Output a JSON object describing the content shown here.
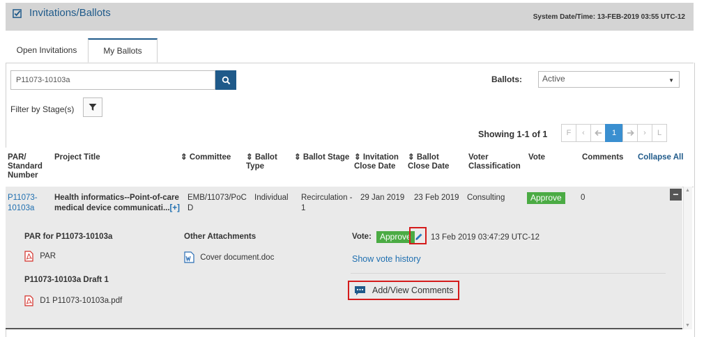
{
  "header": {
    "title": "Invitations/Ballots",
    "system_datetime": "System Date/Time: 13-FEB-2019  03:55 UTC-12"
  },
  "tabs": [
    {
      "label": "Open Invitations",
      "active": false
    },
    {
      "label": "My Ballots",
      "active": true
    }
  ],
  "search": {
    "value": "P11073-10103a"
  },
  "ballots": {
    "label": "Ballots:",
    "selected": "Active"
  },
  "filter": {
    "label": "Filter by Stage(s)"
  },
  "pagination": {
    "showing": "Showing 1-1 of 1",
    "first": "F",
    "prev": "‹",
    "prev2": "🡐",
    "current": "1",
    "next2": "🡒",
    "next": "›",
    "last": "L"
  },
  "table": {
    "headers": {
      "par": "PAR/ Standard Number",
      "title": "Project Title",
      "committee": "⇕ Committee",
      "ballot_type": "⇕ Ballot Type",
      "ballot_stage": "⇕ Ballot Stage",
      "invitation_close": "⇕ Invitation Close Date",
      "ballot_close": "⇕ Ballot Close Date",
      "voter_class": "Voter Classification",
      "vote": "Vote",
      "comments": "Comments",
      "collapse": "Collapse All"
    },
    "row": {
      "par_line1": "P11073-",
      "par_line2": "10103a",
      "title_line1": "Health informatics--Point-of-care",
      "title_line2": "medical device communicati...",
      "expand": "[+]",
      "committee_line1": "EMB/11073/PoC",
      "committee_line2": "D",
      "ballot_type": "Individual",
      "ballot_stage_line1": "Recirculation -",
      "ballot_stage_line2": "1",
      "invitation_close": "29 Jan 2019",
      "ballot_close": "23 Feb 2019",
      "voter_class": "Consulting",
      "vote": "Approve",
      "comments": "0"
    }
  },
  "detail": {
    "par_heading": "PAR for P11073-10103a",
    "par_file": "PAR",
    "draft_heading": "P11073-10103a Draft 1",
    "draft_file": "D1 P11073-10103a.pdf",
    "attachments_heading": "Other Attachments",
    "attachment_file": "Cover document.doc",
    "vote_label": "Vote:",
    "vote_value": "Approve",
    "vote_time": "13 Feb 2019 03:47:29 UTC-12",
    "vote_history": "Show vote history",
    "comments_button": "Add/View Comments"
  },
  "colors": {
    "brand_blue": "#1f5a8a",
    "approve_green": "#4bab44",
    "highlight_red": "#d41b1b"
  }
}
